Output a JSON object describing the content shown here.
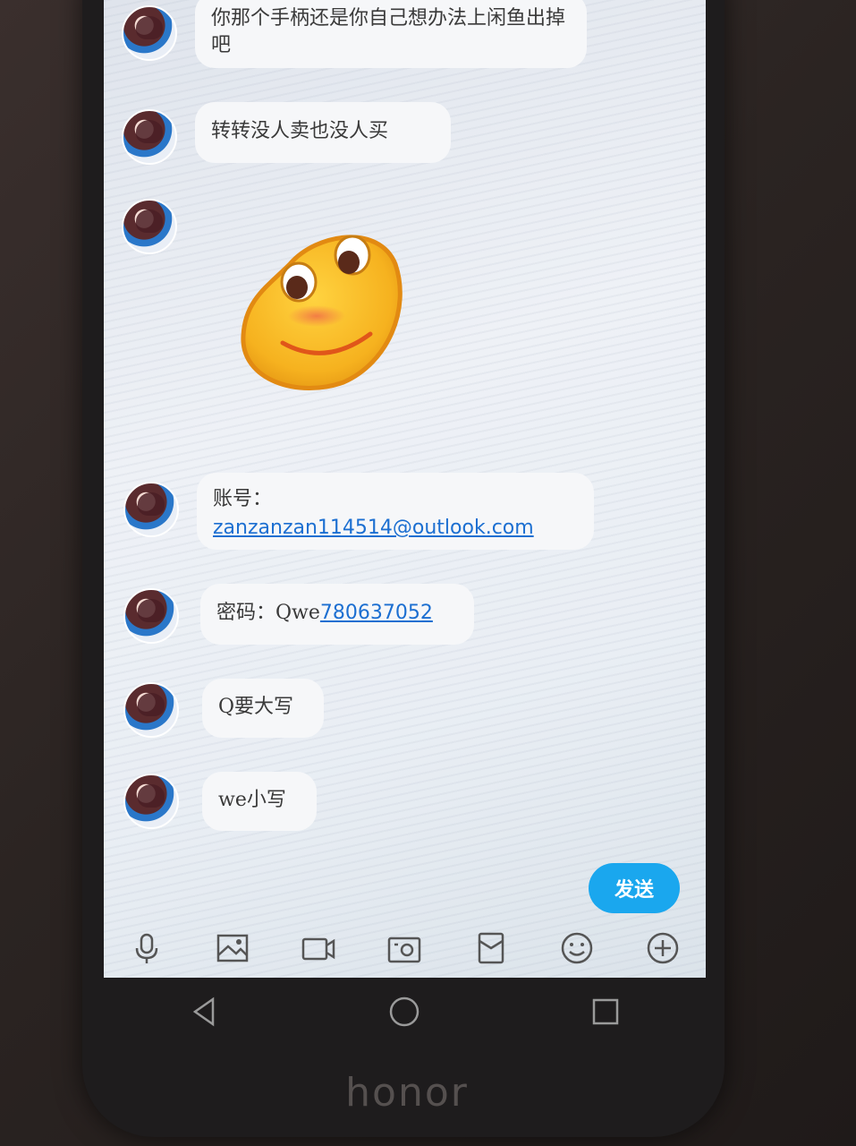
{
  "messages": [
    {
      "text": "你那个手柄还是你自己想办法上闲鱼出掉吧"
    },
    {
      "text": "转转没人卖也没人买"
    },
    {
      "sticker": "smiling-bean-emoji"
    },
    {
      "line1": "账号：",
      "link": "zanzanzan114514@outlook.com"
    },
    {
      "prefix": "密码：Qwe",
      "link": "780637052"
    },
    {
      "text": "Q要大写"
    },
    {
      "text": "we小写"
    }
  ],
  "send_button": {
    "label": "发送",
    "color": "#1aa7ee"
  },
  "toolbar": {
    "icons": [
      "microphone-icon",
      "image-icon",
      "video-icon",
      "camera-icon",
      "red-packet-icon",
      "emoji-icon",
      "plus-icon"
    ]
  },
  "navbar": {
    "icons": [
      "back-icon",
      "home-icon",
      "recents-icon"
    ]
  },
  "device": {
    "brand": "honor"
  }
}
